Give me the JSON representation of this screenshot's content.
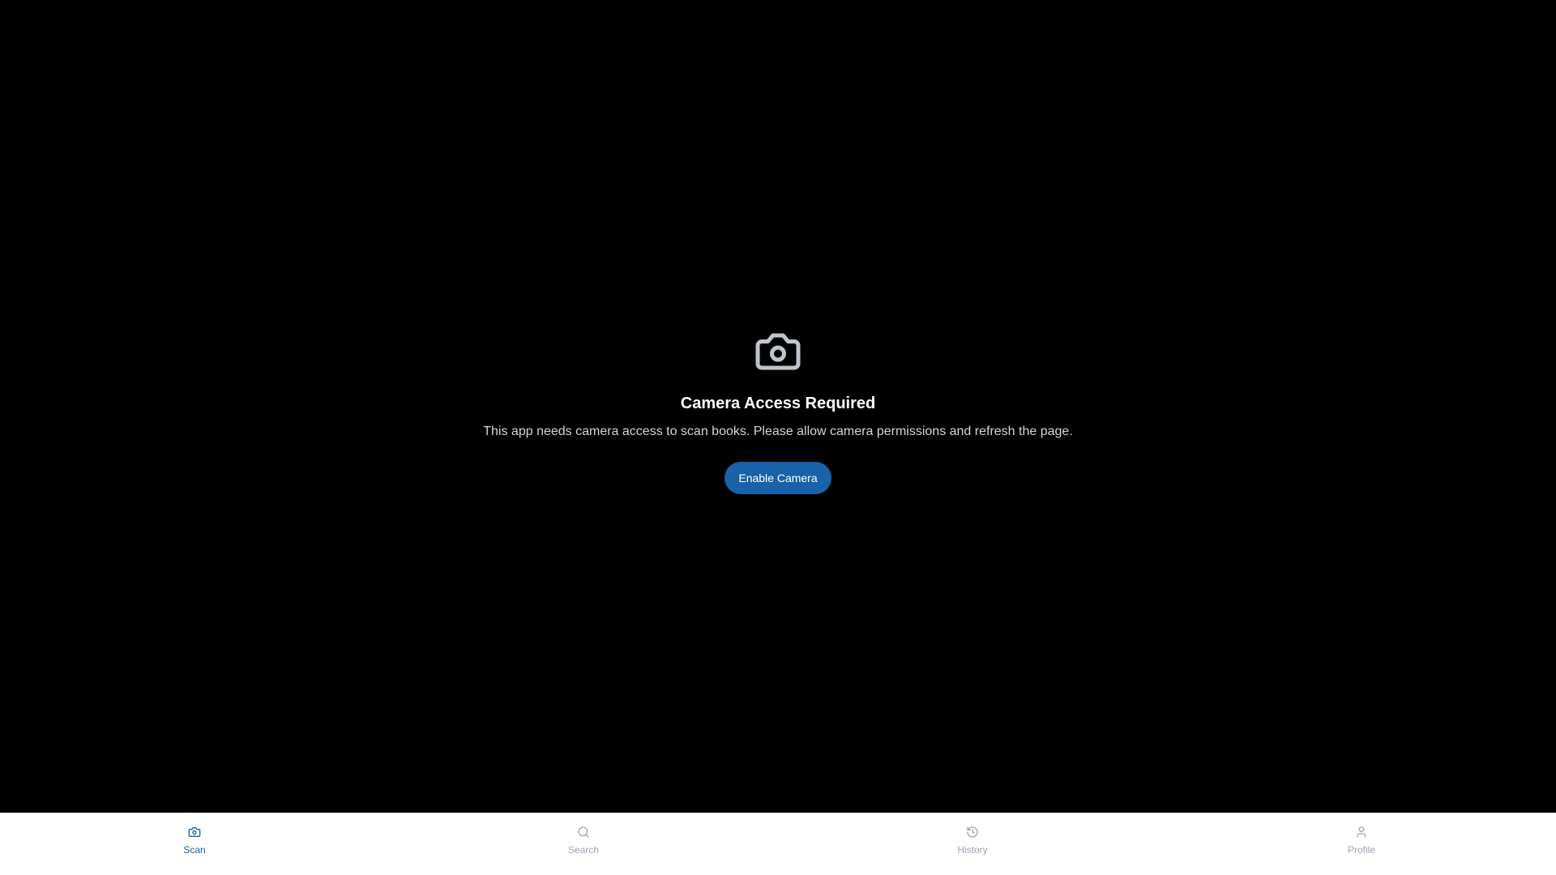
{
  "permission_prompt": {
    "icon": "camera-icon",
    "title": "Camera Access Required",
    "description": "This app needs camera access to scan books. Please allow camera permissions and refresh the page.",
    "button_label": "Enable Camera"
  },
  "bottom_nav": {
    "items": [
      {
        "label": "Scan",
        "icon": "camera-icon",
        "active": true
      },
      {
        "label": "Search",
        "icon": "search-icon",
        "active": false
      },
      {
        "label": "History",
        "icon": "history-icon",
        "active": false
      },
      {
        "label": "Profile",
        "icon": "user-icon",
        "active": false
      }
    ]
  },
  "colors": {
    "background": "#000000",
    "accent": "#1762a8",
    "nav_background": "#ffffff",
    "nav_inactive": "#9ca3af",
    "icon_gray": "#c0c4cc"
  }
}
